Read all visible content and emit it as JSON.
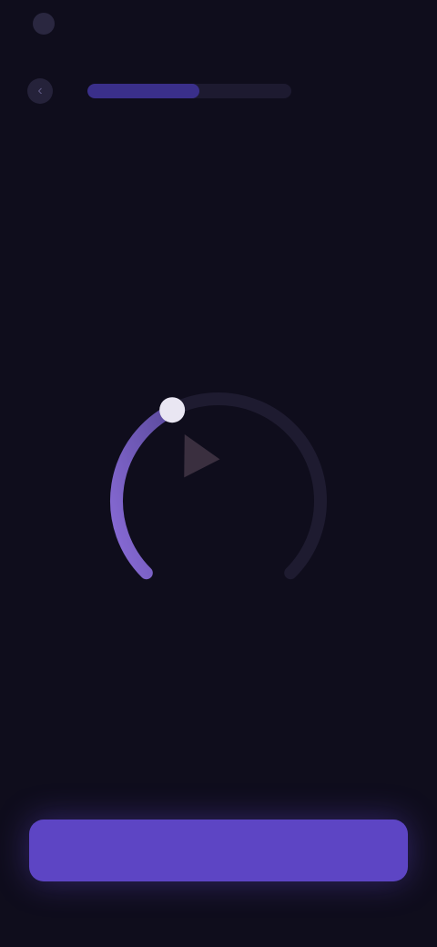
{
  "status_bar": {
    "time": "",
    "indicators": ""
  },
  "nav": {
    "back_icon": "chevron-left-icon",
    "progress": 0.55
  },
  "question": {
    "title": "",
    "subtitle": ""
  },
  "dial": {
    "value": "",
    "caption": "",
    "level": 0.4,
    "colors": {
      "track": "#1e1b30",
      "fill_start": "#8a6cd8",
      "fill_end": "#5a4a9c",
      "knob": "#e9e6f2",
      "pointer": "#3a2f3f"
    }
  },
  "cta": {
    "label": ""
  },
  "colors": {
    "background": "#0f0d1c",
    "accent": "#5d45c4"
  }
}
